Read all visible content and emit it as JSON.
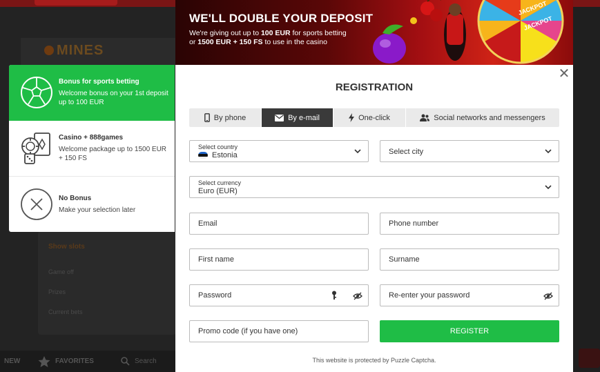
{
  "background": {
    "logo": "MINES",
    "panel_title": "Show slots",
    "panel_rows": [
      "Game off",
      "Prizes",
      "Current bets"
    ],
    "bottom_nav": [
      "NEW",
      "FAVORITES",
      "Search"
    ]
  },
  "bonus": {
    "options": [
      {
        "title": "Bonus for sports betting",
        "desc": "Welcome bonus on your 1st deposit up to 100 EUR",
        "icon": "soccer-ball-icon",
        "selected": true
      },
      {
        "title": "Casino + 888games",
        "desc": "Welcome package up to 1500 EUR + 150 FS",
        "icon": "casino-chips-cards-icon",
        "selected": false
      },
      {
        "title": "No Bonus",
        "desc": "Make your selection later",
        "icon": "no-bonus-x-icon",
        "selected": false
      }
    ]
  },
  "banner": {
    "title": "WE'LL DOUBLE YOUR DEPOSIT",
    "line1_pre": "We're giving out up to ",
    "line1_bold": "100 EUR",
    "line1_post": " for sports betting",
    "line2_pre": "or ",
    "line2_bold": "1500 EUR + 150 FS",
    "line2_post": " to use in the casino",
    "wheel_text": "JACKPOT"
  },
  "modal": {
    "title": "REGISTRATION",
    "close_symbol": "✕",
    "tabs": [
      {
        "label": "By phone",
        "icon": "phone-icon",
        "active": false
      },
      {
        "label": "By e-mail",
        "icon": "envelope-icon",
        "active": true
      },
      {
        "label": "One-click",
        "icon": "lightning-icon",
        "active": false
      },
      {
        "label": "Social networks and messengers",
        "icon": "users-icon",
        "active": false
      }
    ],
    "country": {
      "label": "Select country",
      "value": "Estonia"
    },
    "city": {
      "placeholder": "Select city"
    },
    "currency": {
      "label": "Select currency",
      "value": "Euro (EUR)"
    },
    "email": {
      "placeholder": "Email"
    },
    "phone": {
      "placeholder": "Phone number"
    },
    "first_name": {
      "placeholder": "First name"
    },
    "surname": {
      "placeholder": "Surname"
    },
    "password": {
      "placeholder": "Password"
    },
    "repassword": {
      "placeholder": "Re-enter your password"
    },
    "promo": {
      "placeholder": "Promo code (if you have one)"
    },
    "register_label": "REGISTER",
    "captcha_text": "This website is protected by Puzzle Captcha."
  },
  "colors": {
    "accent_green": "#1fbd46",
    "active_tab": "#3a3a3a",
    "banner_red": "#a40f12"
  }
}
